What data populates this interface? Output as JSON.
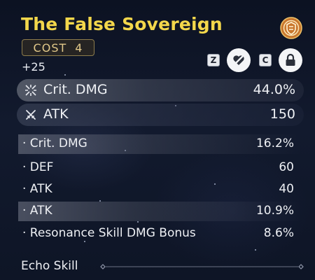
{
  "item": {
    "name": "The False Sovereign",
    "cost_label": "COST",
    "cost_value": "4",
    "level": "+25"
  },
  "controls": {
    "discard_key": "Z",
    "lock_key": "C",
    "discard_icon": "heart-slash-icon",
    "lock_icon": "lock-icon"
  },
  "main_stats": [
    {
      "label": "Crit. DMG",
      "value": "44.0%",
      "icon": "crit-burst-icon"
    },
    {
      "label": "ATK",
      "value": "150",
      "icon": "crossed-swords-icon"
    }
  ],
  "sub_stats": [
    {
      "label": "· Crit. DMG",
      "value": "16.2%"
    },
    {
      "label": "· DEF",
      "value": "60"
    },
    {
      "label": "· ATK",
      "value": "40"
    },
    {
      "label": "· ATK",
      "value": "10.9%"
    },
    {
      "label": "· Resonance Skill DMG Bonus",
      "value": "8.6%"
    }
  ],
  "section": {
    "echo_skill": "Echo Skill"
  },
  "colors": {
    "title": "#f3d74b",
    "cost_border": "#8d7c4c",
    "text": "#eef0f4"
  }
}
